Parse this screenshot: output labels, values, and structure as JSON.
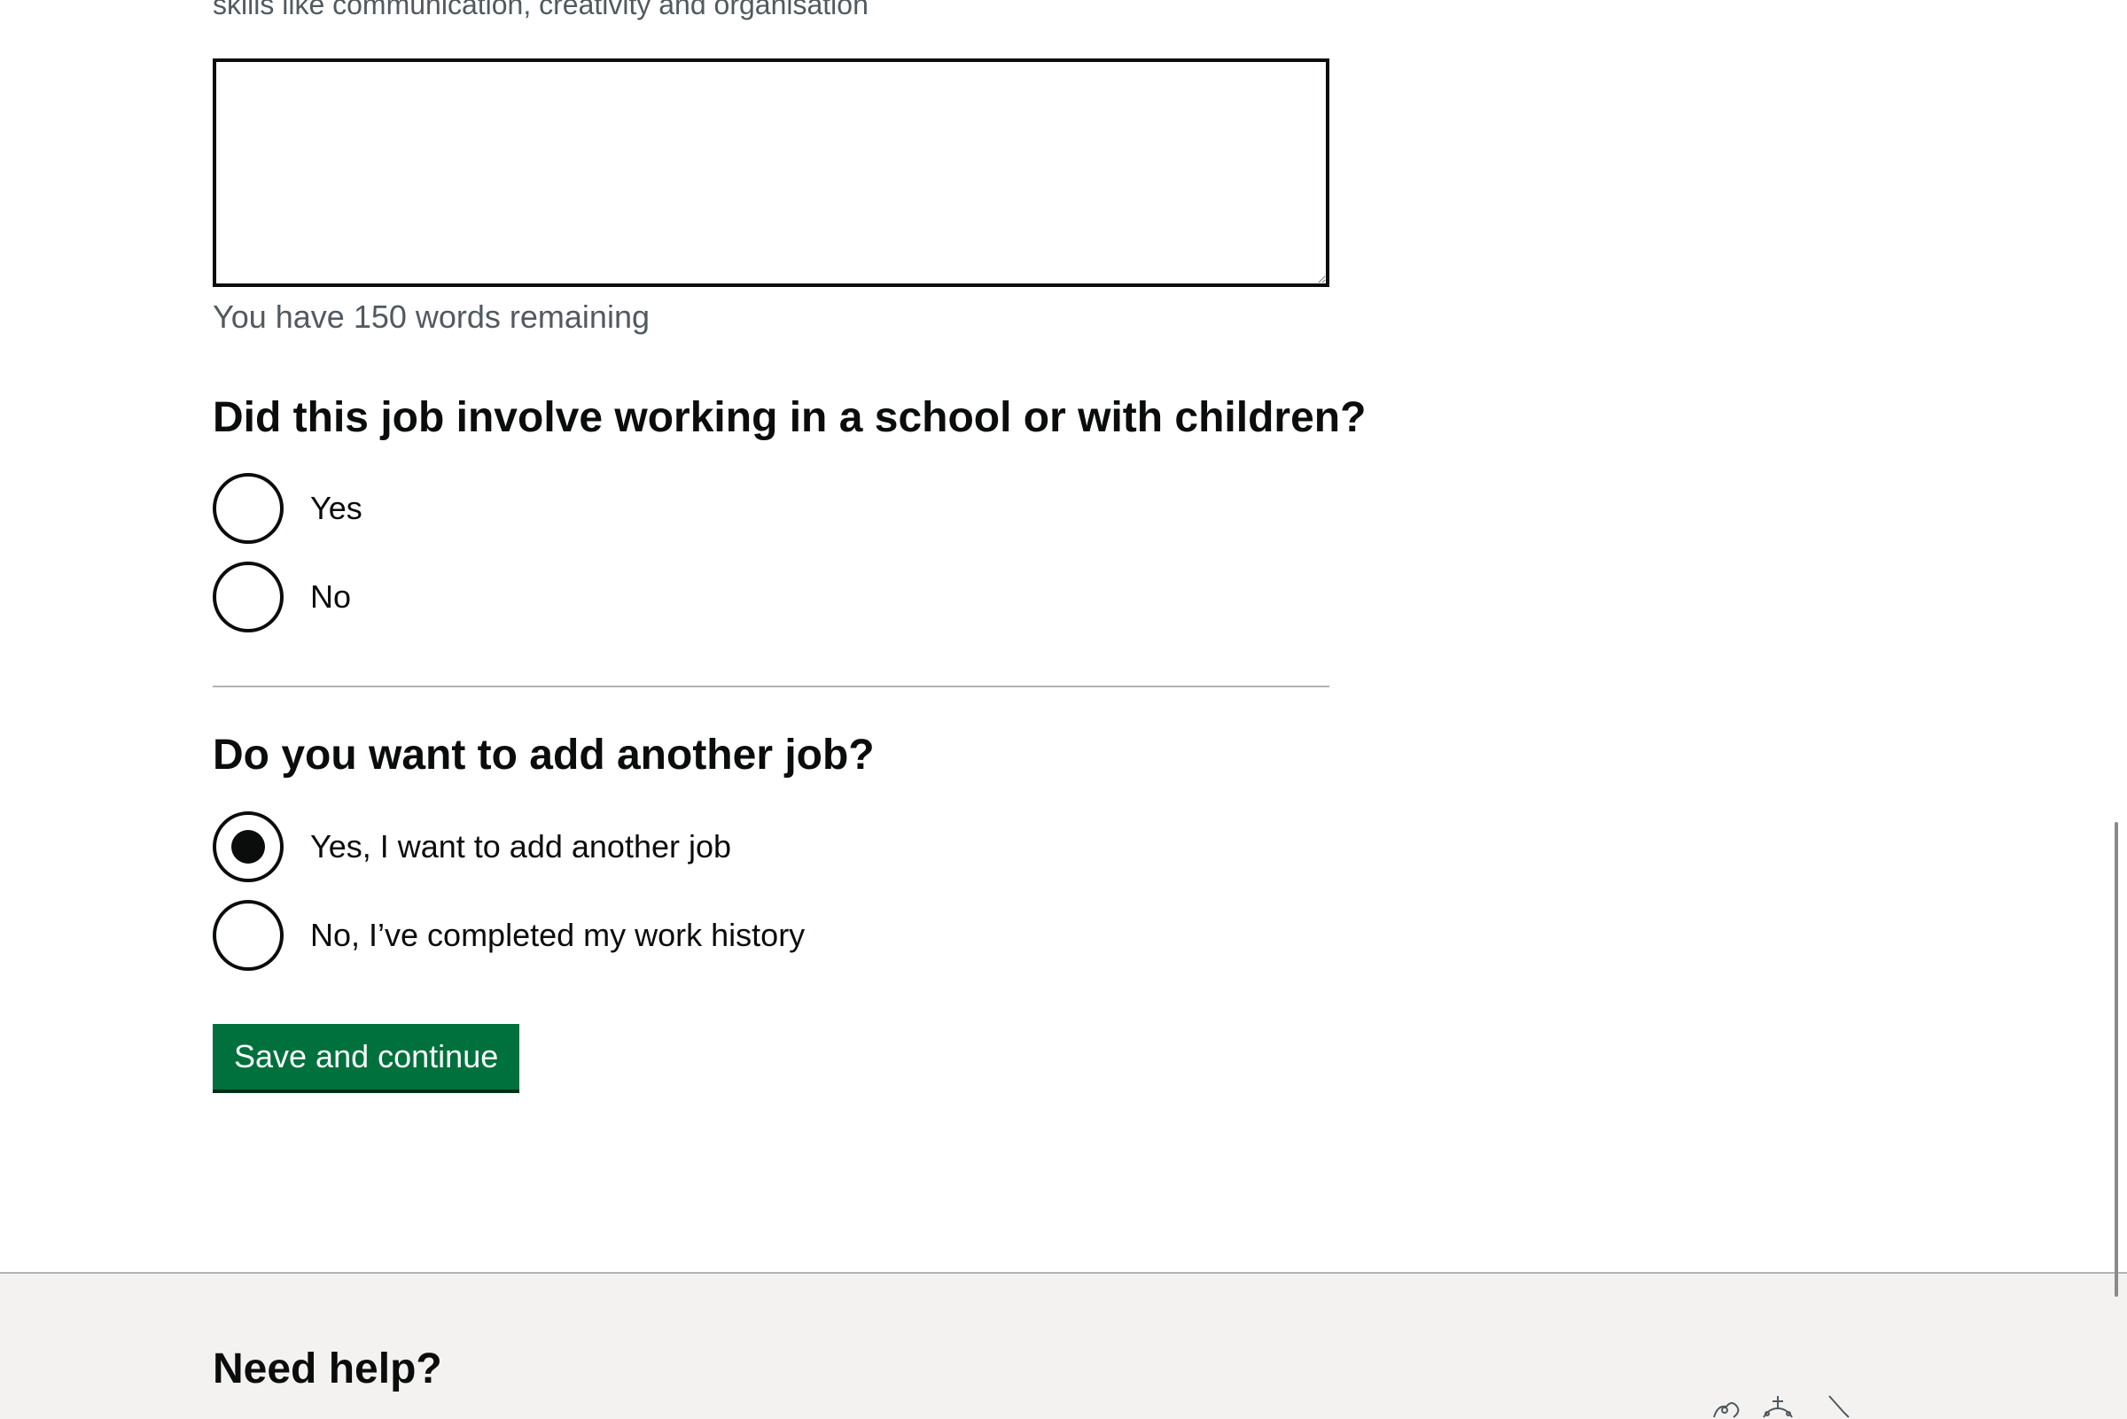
{
  "form": {
    "skills_hint": "skills like communication, creativity and organisation",
    "description_value": "",
    "word_count": "You have 150 words remaining",
    "children_question": {
      "legend": "Did this job involve working in a school or with children?",
      "options": [
        {
          "label": "Yes",
          "checked": false
        },
        {
          "label": "No",
          "checked": false
        }
      ]
    },
    "another_job_question": {
      "legend": "Do you want to add another job?",
      "options": [
        {
          "label": "Yes, I want to add another job",
          "checked": true
        },
        {
          "label": "No, I’ve completed my work history",
          "checked": false
        }
      ]
    },
    "submit_label": "Save and continue"
  },
  "footer": {
    "heading": "Need help?",
    "logo_icon": "royal-coat-of-arms-icon"
  },
  "colors": {
    "button": "#00703c",
    "button_shadow": "#002d18",
    "text": "#0b0c0c",
    "secondary_text": "#505a5f",
    "footer_bg": "#f3f2f1",
    "border": "#b1b4b6"
  }
}
